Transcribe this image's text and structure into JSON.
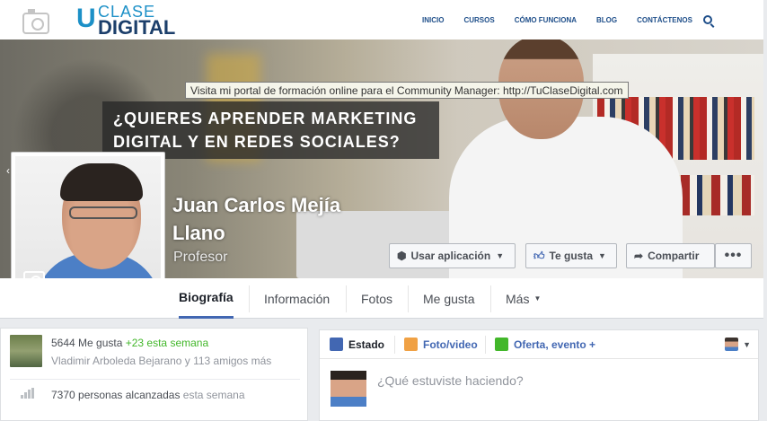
{
  "site": {
    "brand_top": "CLASE",
    "brand_bottom": "DIGITAL",
    "nav": [
      "INICIO",
      "CURSOS",
      "CÓMO FUNCIONA",
      "BLOG",
      "CONTÁCTENOS"
    ]
  },
  "cover": {
    "tooltip": "Visita mi portal de formación online para el Community Manager: http://TuClaseDigital.com",
    "headline_line1": "¿QUIERES APRENDER MARKETING",
    "headline_line2": "DIGITAL Y EN REDES SOCIALES?"
  },
  "profile": {
    "name_line1": "Juan Carlos Mejía",
    "name_line2": "Llano",
    "role": "Profesor"
  },
  "actions": {
    "app": "Usar aplicación",
    "like": "Te gusta",
    "share": "Compartir",
    "more": "•••"
  },
  "tabs": [
    "Biografía",
    "Información",
    "Fotos",
    "Me gusta",
    "Más"
  ],
  "stats": {
    "likes": "5644 Me gusta",
    "likes_week": "+23 esta semana",
    "friends": "Vladimir Arboleda Bejarano y 113 amigos más",
    "reach": "7370 personas alcanzadas",
    "reach_week": "esta semana"
  },
  "composer": {
    "status": "Estado",
    "photo": "Foto/video",
    "offer": "Oferta, evento +",
    "placeholder": "¿Qué estuviste haciendo?"
  },
  "colors": {
    "accent": "#4267b2",
    "brand_blue": "#1c90c7",
    "green": "#42b72a"
  }
}
